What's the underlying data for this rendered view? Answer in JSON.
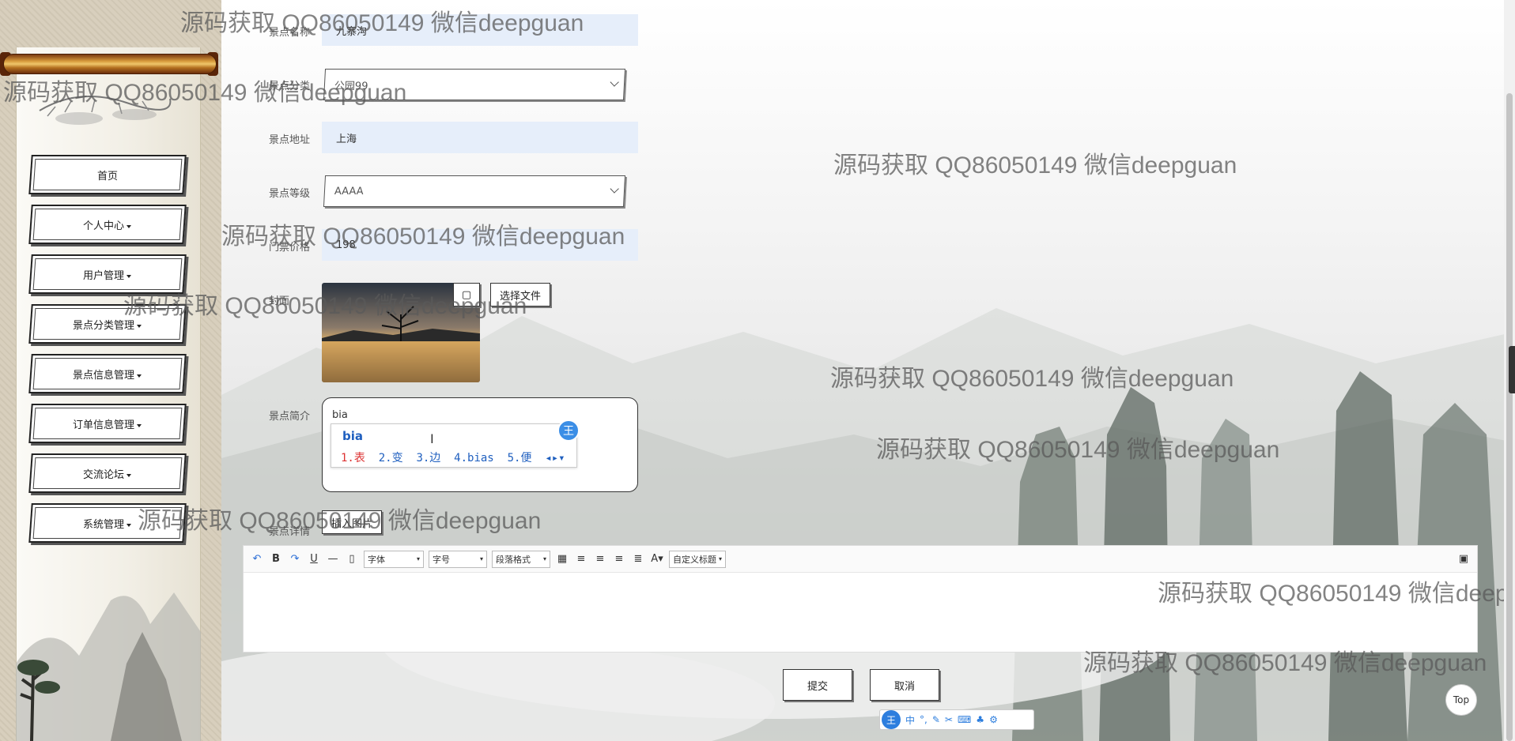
{
  "sidebar": {
    "items": [
      {
        "label": "首页",
        "has_dropdown": false
      },
      {
        "label": "个人中心",
        "has_dropdown": true
      },
      {
        "label": "用户管理",
        "has_dropdown": true
      },
      {
        "label": "景点分类管理",
        "has_dropdown": true
      },
      {
        "label": "景点信息管理",
        "has_dropdown": true
      },
      {
        "label": "订单信息管理",
        "has_dropdown": true
      },
      {
        "label": "交流论坛",
        "has_dropdown": true
      },
      {
        "label": "系统管理",
        "has_dropdown": true
      }
    ]
  },
  "form": {
    "name_label": "景点名称",
    "name_value": "九寨沟",
    "category_label": "景点分类",
    "category_value": "公园99",
    "address_label": "景点地址",
    "address_value": "上海",
    "level_label": "景点等级",
    "level_value": "AAAA",
    "price_label": "门票价格",
    "price_value": "198",
    "cover_label": "封面",
    "choose_file_label": "选择文件",
    "intro_label": "景点简介",
    "intro_value": "bia",
    "detail_label": "景点详情",
    "insert_image_label": "插入图片"
  },
  "ime": {
    "input": "bia",
    "candidates": [
      "1.表",
      "2.变",
      "3.边",
      "4.bias",
      "5.便"
    ],
    "logo": "王",
    "bar_items": [
      "中"
    ]
  },
  "editor": {
    "toolbar_icons": [
      "undo-icon",
      "bold-icon",
      "redo-icon",
      "underline-icon",
      "hr-icon",
      "page-icon"
    ],
    "font_label": "字体",
    "size_label": "字号",
    "paragraph_label": "段落格式",
    "custom_title_label": "自定义标题",
    "font_color_glyph": "A"
  },
  "actions": {
    "submit_label": "提交",
    "cancel_label": "取消",
    "top_label": "Top"
  },
  "watermark": "源码获取 QQ86050149 微信deepguan"
}
